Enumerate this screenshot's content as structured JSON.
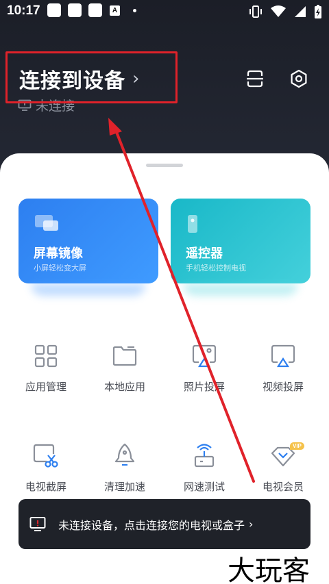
{
  "status_bar": {
    "time": "10:17",
    "a_badge": "A"
  },
  "header": {
    "title": "连接到设备",
    "chevron": "›",
    "connection_status": "未连接"
  },
  "cards": [
    {
      "title": "屏幕镜像",
      "subtitle": "小屏轻松变大屏"
    },
    {
      "title": "遥控器",
      "subtitle": "手机轻松控制电视"
    }
  ],
  "grid": [
    {
      "label": "应用管理",
      "icon": "apps-grid-icon"
    },
    {
      "label": "本地应用",
      "icon": "folder-icon"
    },
    {
      "label": "照片投屏",
      "icon": "photo-cast-icon"
    },
    {
      "label": "视频投屏",
      "icon": "video-cast-icon"
    },
    {
      "label": "电视截屏",
      "icon": "screenshot-scissors-icon"
    },
    {
      "label": "清理加速",
      "icon": "rocket-icon"
    },
    {
      "label": "网速测试",
      "icon": "router-icon"
    },
    {
      "label": "电视会员",
      "icon": "vip-diamond-icon"
    }
  ],
  "vip_badge": "VIP",
  "toast": {
    "message": "未连接设备，点击连接您的电视或盒子",
    "chevron": "›"
  },
  "watermark": "大玩客",
  "colors": {
    "accent_blue": "#2d7ff0",
    "accent_teal": "#19b8c8",
    "annotation_red": "#e0222a",
    "dark_bg": "#1b1e27"
  }
}
